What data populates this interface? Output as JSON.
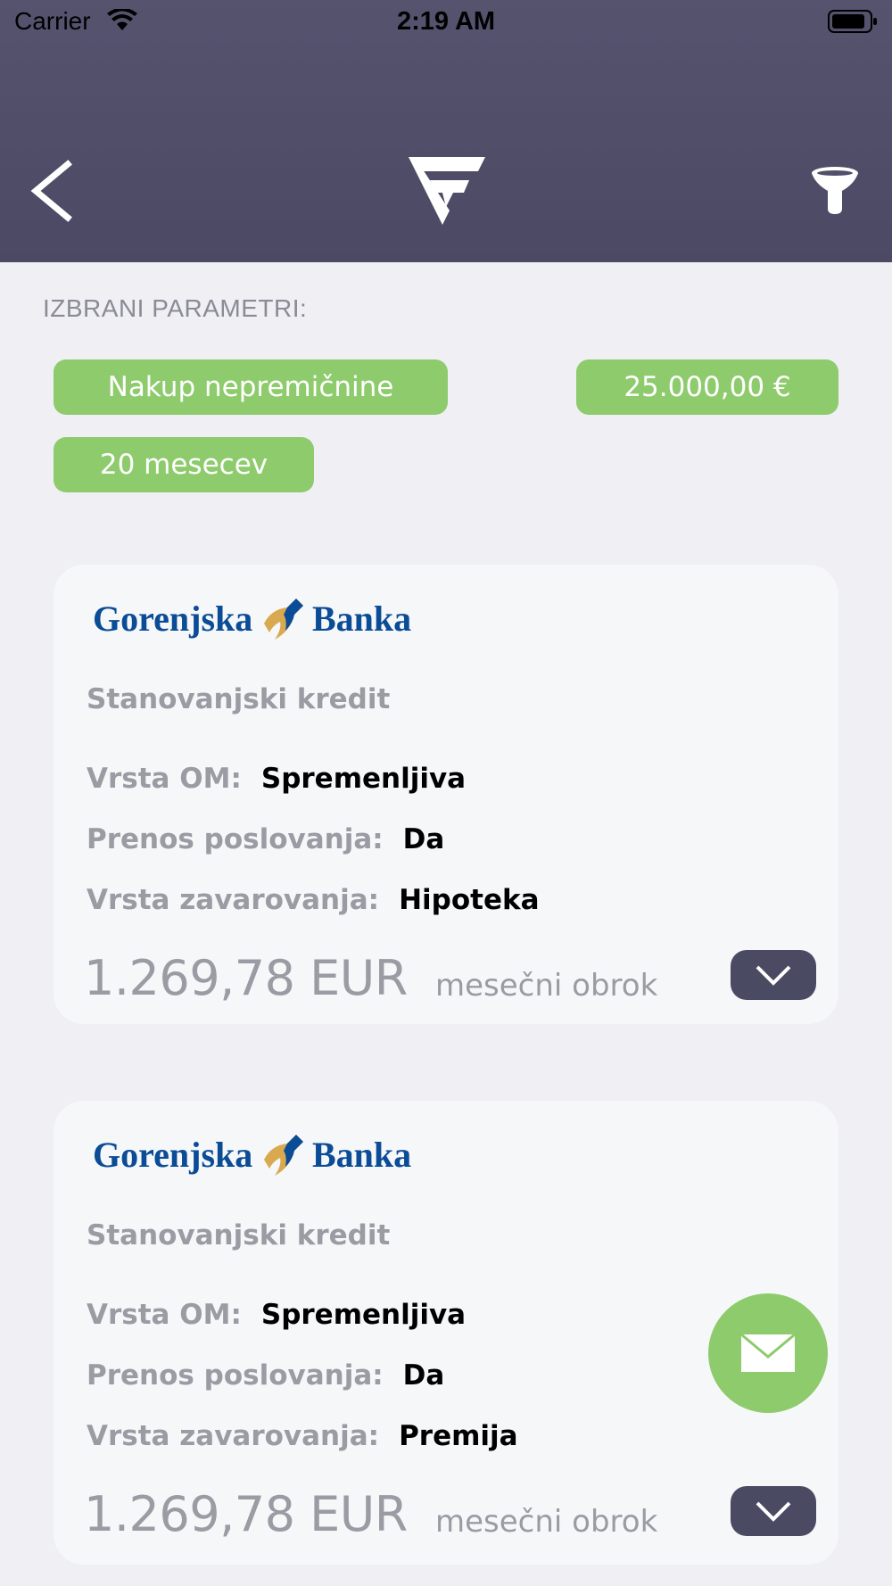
{
  "status_bar": {
    "carrier": "Carrier",
    "time": "2:19 AM"
  },
  "nav": {
    "back_icon": "chevron-left-icon",
    "logo": "app-logo",
    "filter_icon": "filter-funnel-icon"
  },
  "params": {
    "label": "IZBRANI PARAMETRI:",
    "chips": [
      "Nakup nepremičnine",
      "25.000,00 €",
      "20 mesecev"
    ]
  },
  "offers": [
    {
      "bank": "Gorenjska Banka",
      "bank_left": "Gorenjska",
      "bank_right": "Banka",
      "product": "Stanovanjski kredit",
      "rows": [
        {
          "label": "Vrsta OM:",
          "value": "Spremenljiva"
        },
        {
          "label": "Prenos poslovanja:",
          "value": "Da"
        },
        {
          "label": "Vrsta zavarovanja:",
          "value": "Hipoteka"
        }
      ],
      "price": "1.269,78 EUR",
      "price_caption": "mesečni obrok"
    },
    {
      "bank": "Gorenjska Banka",
      "bank_left": "Gorenjska",
      "bank_right": "Banka",
      "product": "Stanovanjski kredit",
      "rows": [
        {
          "label": "Vrsta OM:",
          "value": "Spremenljiva"
        },
        {
          "label": "Prenos poslovanja:",
          "value": "Da"
        },
        {
          "label": "Vrsta zavarovanja:",
          "value": "Premija"
        }
      ],
      "price": "1.269,78 EUR",
      "price_caption": "mesečni obrok"
    }
  ],
  "colors": {
    "header": "#514f6a",
    "accent_green": "#8ecb6c",
    "button_dark": "#4a4a63",
    "bank_blue": "#0a4c96",
    "bank_gold": "#d9a94f"
  }
}
